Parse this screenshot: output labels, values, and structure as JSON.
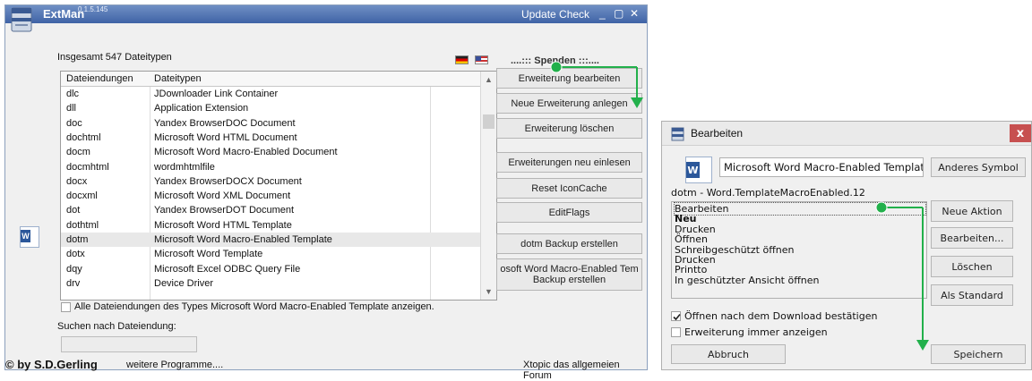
{
  "main_window": {
    "title": "ExtMan",
    "version": "0.1.5.145",
    "update_check": "Update Check",
    "minimize_glyph": "_",
    "maximize_glyph": "▢",
    "close_glyph": "✕",
    "total_label": "Insgesamt 547 Dateitypen",
    "spenden": "....::: Spenden :::....",
    "table": {
      "headers": [
        "Dateiendungen",
        "Dateitypen"
      ],
      "rows": [
        {
          "ext": "dlc",
          "type": "JDownloader Link Container"
        },
        {
          "ext": "dll",
          "type": "Application Extension"
        },
        {
          "ext": "doc",
          "type": "Yandex BrowserDOC Document"
        },
        {
          "ext": "dochtml",
          "type": "Microsoft Word HTML Document"
        },
        {
          "ext": "docm",
          "type": "Microsoft Word Macro-Enabled Document"
        },
        {
          "ext": "docmhtml",
          "type": "wordmhtmlfile"
        },
        {
          "ext": "docx",
          "type": "Yandex BrowserDOCX Document"
        },
        {
          "ext": "docxml",
          "type": "Microsoft Word XML Document"
        },
        {
          "ext": "dot",
          "type": "Yandex BrowserDOT Document"
        },
        {
          "ext": "dothtml",
          "type": "Microsoft Word HTML Template"
        },
        {
          "ext": "dotm",
          "type": "Microsoft Word Macro-Enabled Template"
        },
        {
          "ext": "dotx",
          "type": "Microsoft Word Template"
        },
        {
          "ext": "dqy",
          "type": "Microsoft Excel ODBC Query File"
        },
        {
          "ext": "drv",
          "type": "Device Driver"
        }
      ],
      "selected_index": 10
    },
    "buttons": {
      "edit": "Erweiterung bearbeiten",
      "new": "Neue Erweiterung anlegen",
      "delete": "Erweiterung löschen",
      "reload": "Erweiterungen neu einlesen",
      "reset_cache": "Reset IconCache",
      "editflags": "EditFlags",
      "backup": "dotm Backup erstellen",
      "backup_type_line1": "osoft Word Macro-Enabled Tem",
      "backup_type_line2": "Backup erstellen"
    },
    "show_all_checkbox": "Alle Dateiendungen des Types Microsoft Word Macro-Enabled Template anzeigen.",
    "search_label": "Suchen nach Dateiendung:",
    "search_value": "",
    "footer_copyright": "© by S.D.Gerling",
    "footer_more": "weitere Programme....",
    "footer_forum": "Xtopic das allgemeien Forum"
  },
  "edit_dialog": {
    "title": "Bearbeiten",
    "close_glyph": "x",
    "type_name": "Microsoft Word Macro-Enabled Template",
    "other_icon_button": "Anderes Symbol",
    "prog_id": "dotm - Word.TemplateMacroEnabled.12",
    "actions": [
      {
        "label": "Bearbeiten",
        "bold": false
      },
      {
        "label": "Neu",
        "bold": true
      },
      {
        "label": "Drucken",
        "bold": false
      },
      {
        "label": "Öffnen",
        "bold": false
      },
      {
        "label": "Schreibgeschützt öffnen",
        "bold": false
      },
      {
        "label": "Drucken",
        "bold": false
      },
      {
        "label": "Printto",
        "bold": false
      },
      {
        "label": "In geschützter Ansicht öffnen",
        "bold": false
      }
    ],
    "buttons": {
      "new_action": "Neue Aktion",
      "edit": "Bearbeiten...",
      "delete": "Löschen",
      "set_default": "Als Standard",
      "cancel": "Abbruch",
      "save": "Speichern"
    },
    "confirm_open_checkbox": {
      "label": "Öffnen nach dem Download bestätigen",
      "checked": true
    },
    "always_show_checkbox": {
      "label": "Erweiterung immer anzeigen",
      "checked": false
    }
  },
  "colors": {
    "title_bar": "#4a6fb0",
    "annotation_arrow": "#22b04b",
    "selected_row": "#e8e8e8",
    "close_button": "#c75050"
  },
  "icons": [
    "extman-app-icon",
    "german-flag-icon",
    "us-flag-icon",
    "word-document-icon",
    "scroll-up-icon",
    "scroll-down-icon",
    "close-icon"
  ]
}
